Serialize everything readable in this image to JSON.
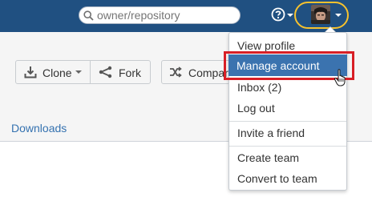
{
  "header": {
    "search_placeholder": "owner/repository",
    "help_icon": "help-circle-icon",
    "search_icon": "search-icon"
  },
  "toolbar": {
    "clone_label": "Clone",
    "fork_label": "Fork",
    "compare_label": "Compar"
  },
  "nav": {
    "downloads_label": "Downloads"
  },
  "user_menu": {
    "items": [
      {
        "label": "View profile"
      },
      {
        "label": "Manage account"
      },
      {
        "label": "Inbox (2)"
      },
      {
        "label": "Log out"
      },
      {
        "label": "Invite a friend"
      },
      {
        "label": "Create team"
      },
      {
        "label": "Convert to team"
      }
    ],
    "highlighted_index": 1
  },
  "colors": {
    "topbar": "#205081",
    "accent_highlight": "#3b73af",
    "annotation_red": "#d81f26",
    "annotation_yellow": "#f7c22e",
    "link": "#3572b0"
  }
}
